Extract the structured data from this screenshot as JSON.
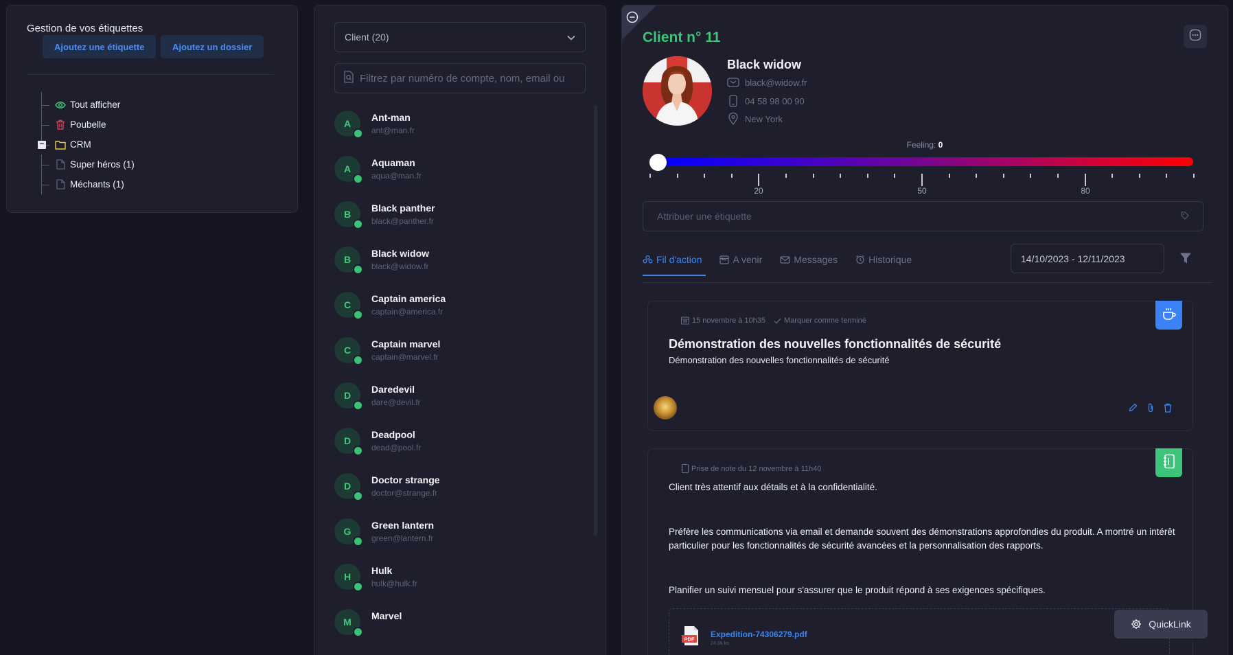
{
  "colors": {
    "background": "#161622",
    "panel": "#1e1e2d",
    "accent_blue": "#3c86f0",
    "accent_green": "#3cc478",
    "danger": "#e5384f",
    "folder": "#f2c94c"
  },
  "tag_manager": {
    "title": "Gestion de vos étiquettes",
    "add_tag_label": "Ajoutez une étiquette",
    "add_folder_label": "Ajoutez un dossier",
    "tree": {
      "show_all": "Tout afficher",
      "trash": "Poubelle",
      "crm": "CRM",
      "super_heroes": "Super héros (1)",
      "villains": "Méchants (1)"
    }
  },
  "client_list": {
    "select_value": "Client (20)",
    "filter_placeholder": "Filtrez par numéro de compte, nom, email ou",
    "items": [
      {
        "initial": "A",
        "name": "Ant-man",
        "email": "ant@man.fr"
      },
      {
        "initial": "A",
        "name": "Aquaman",
        "email": "aqua@man.fr"
      },
      {
        "initial": "B",
        "name": "Black panther",
        "email": "black@panther.fr"
      },
      {
        "initial": "B",
        "name": "Black widow",
        "email": "black@widow.fr"
      },
      {
        "initial": "C",
        "name": "Captain america",
        "email": "captain@america.fr"
      },
      {
        "initial": "C",
        "name": "Captain marvel",
        "email": "captain@marvel.fr"
      },
      {
        "initial": "D",
        "name": "Daredevil",
        "email": "dare@devil.fr"
      },
      {
        "initial": "D",
        "name": "Deadpool",
        "email": "dead@pool.fr"
      },
      {
        "initial": "D",
        "name": "Doctor strange",
        "email": "doctor@strange.fr"
      },
      {
        "initial": "G",
        "name": "Green lantern",
        "email": "green@lantern.fr"
      },
      {
        "initial": "H",
        "name": "Hulk",
        "email": "hulk@hulk.fr"
      },
      {
        "initial": "M",
        "name": "Marvel",
        "email": ""
      }
    ]
  },
  "detail": {
    "client_title": "Client n° 11",
    "name": "Black widow",
    "email": "black@widow.fr",
    "phone": "04 58 98 00 90",
    "city": "New York",
    "feeling_label": "Feeling:",
    "feeling_value": "0",
    "feeling_percent": 0,
    "scale_labels": [
      "20",
      "50",
      "80"
    ],
    "tag_placeholder": "Attribuer une étiquette",
    "tabs": [
      "Fil d'action",
      "A venir",
      "Messages",
      "Historique"
    ],
    "date_range": "14/10/2023 - 12/11/2023"
  },
  "event_card": {
    "date": "15 novembre à 10h35",
    "mark_done": "Marquer comme terminé",
    "title": "Démonstration des nouvelles fonctionnalités de sécurité",
    "subtitle": "Démonstration des nouvelles fonctionnalités de sécurité"
  },
  "note_card": {
    "meta": "Prise de note du 12 novembre à 11h40",
    "p1": "Client très attentif aux détails et à la confidentialité.",
    "p2": "Préfère les communications via email et demande souvent des démonstrations approfondies du produit. A montré un intérêt particulier pour les fonctionnalités de sécurité avancées et la personnalisation des rapports.",
    "p3": "Planifier un suivi mensuel pour s'assurer que le produit répond à ses exigences spécifiques.",
    "attachment_name": "Expedition-74306279.pdf",
    "attachment_size": "24.08 ko",
    "pdf_label": "PDF"
  },
  "quicklink_label": "QuickLink"
}
